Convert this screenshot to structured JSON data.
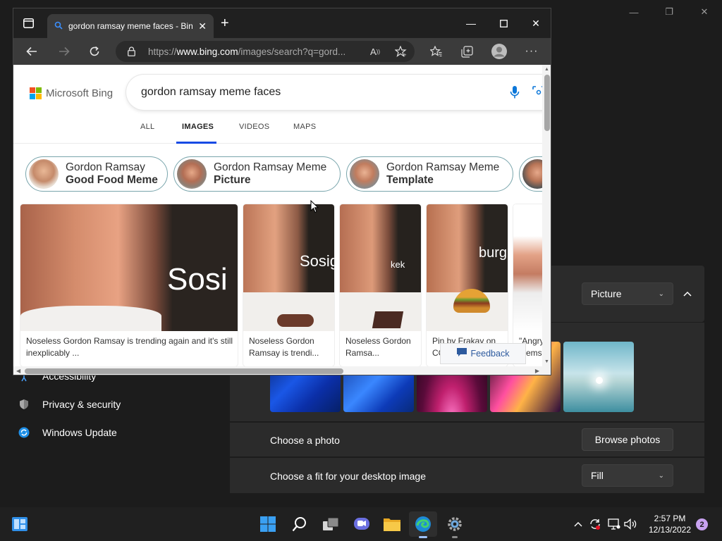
{
  "settings": {
    "sidebar": {
      "items": [
        {
          "label": "Accessibility"
        },
        {
          "label": "Privacy & security"
        },
        {
          "label": "Windows Update"
        }
      ]
    },
    "background_type": "Picture",
    "choose_photo_label": "Choose a photo",
    "browse_photos": "Browse photos",
    "fit_label": "Choose a fit for your desktop image",
    "fit_value": "Fill"
  },
  "browser": {
    "tab_title": "gordon ramsay meme faces - Bing",
    "address_prefix": "https://",
    "address_domain": "www.bing.com",
    "address_path": "/images/search?q=gord...",
    "logo_text": "Microsoft Bing",
    "search_query": "gordon ramsay meme faces",
    "nav_tabs": [
      {
        "label": "ALL"
      },
      {
        "label": "IMAGES"
      },
      {
        "label": "VIDEOS"
      },
      {
        "label": "MAPS"
      }
    ],
    "pills": [
      {
        "line1": "Gordon Ramsay",
        "line2": "Good Food Meme"
      },
      {
        "line1": "Gordon Ramsay Meme",
        "line2": "Picture"
      },
      {
        "line1": "Gordon Ramsay Meme",
        "line2": "Template"
      }
    ],
    "cards": [
      {
        "overlay": "Sosi",
        "caption": "Noseless Gordon Ramsay is trending again and it's still inexplicably ..."
      },
      {
        "overlay": "Sosig",
        "caption": "Noseless Gordon Ramsay is trendi..."
      },
      {
        "overlay": "kek",
        "caption": "Noseless Gordon Ramsa..."
      },
      {
        "overlay": "burg",
        "caption": "Pin by Frakay on CC..."
      },
      {
        "overlay": "",
        "caption": "\"Angry Mems"
      }
    ],
    "feedback": "Feedback"
  },
  "taskbar": {
    "time": "2:57 PM",
    "date": "12/13/2022",
    "notifications": "2"
  },
  "colors": {
    "accent": "#174ae4",
    "taskbar": "#202020",
    "pill_border": "#79a5ac"
  }
}
